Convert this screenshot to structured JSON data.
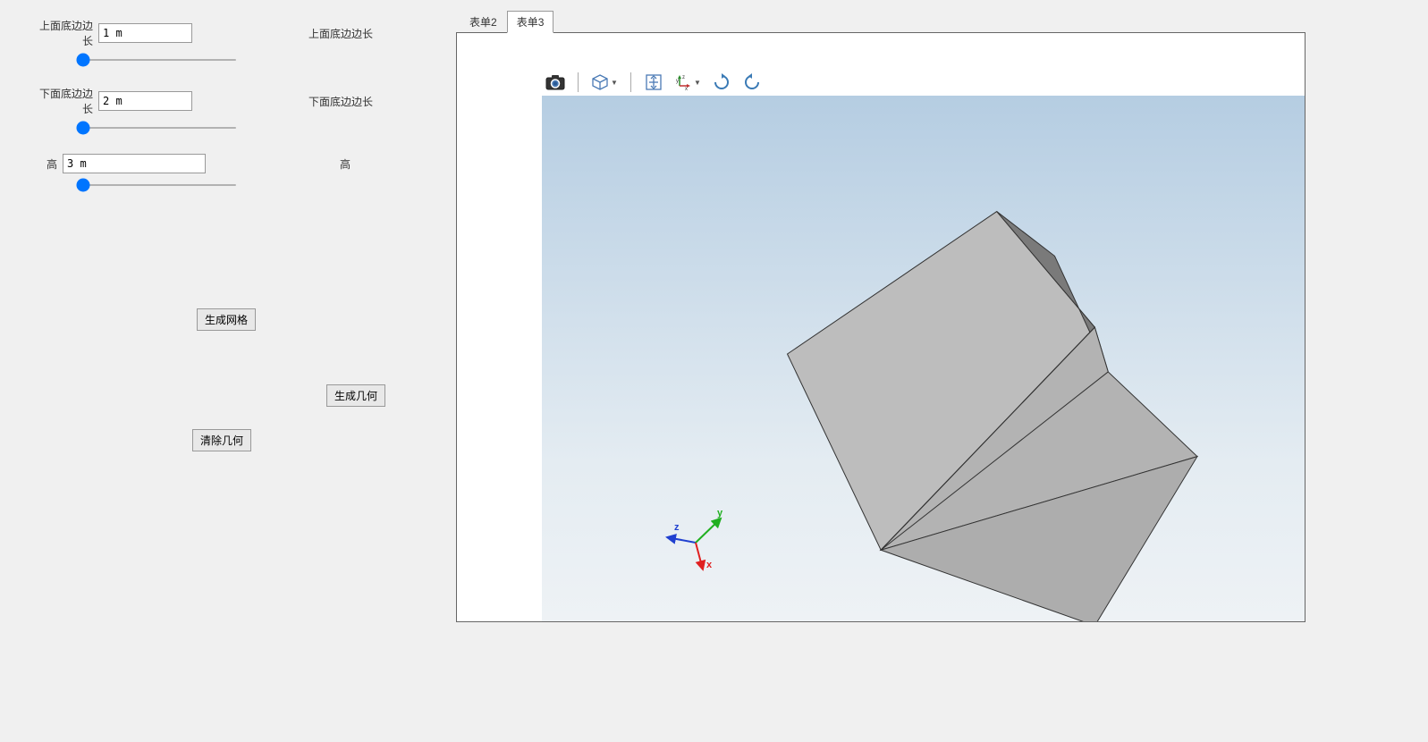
{
  "params": {
    "top": {
      "label": "上面底边边长",
      "value": "1 m",
      "sub": "上面底边边长"
    },
    "bottom": {
      "label": "下面底边边长",
      "value": "2 m",
      "sub": "下面底边边长"
    },
    "height": {
      "label": "高",
      "value": "3 m",
      "sub": "高"
    }
  },
  "buttons": {
    "mesh": "生成网格",
    "geom": "生成几何",
    "clear": "清除几何"
  },
  "tabs": {
    "t2": "表单2",
    "t3": "表单3"
  },
  "toolbar": {
    "camera": "camera-icon",
    "cube": "cube-icon",
    "extents": "zoom-extents-icon",
    "axes": "axes-icon",
    "rotcw": "rotate-cw-icon",
    "rotccw": "rotate-ccw-icon"
  },
  "axis": {
    "x": "x",
    "y": "y",
    "z": "z"
  }
}
